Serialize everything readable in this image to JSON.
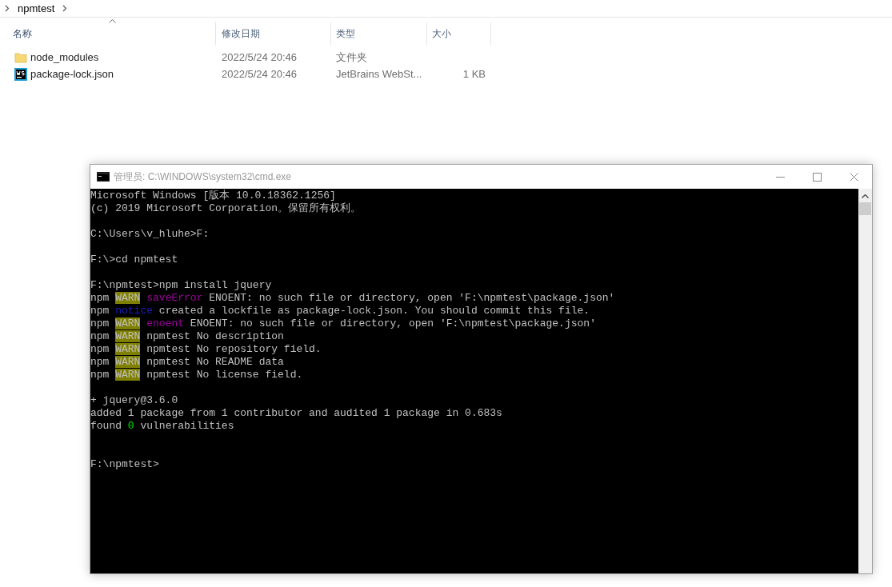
{
  "explorer": {
    "breadcrumb": [
      "npmtest"
    ],
    "columns": [
      {
        "label": "名称",
        "sorted": true
      },
      {
        "label": "修改日期",
        "sorted": false
      },
      {
        "label": "类型",
        "sorted": false
      },
      {
        "label": "大小",
        "sorted": false
      }
    ],
    "rows": [
      {
        "kind": "folder",
        "name": "node_modules",
        "date": "2022/5/24 20:46",
        "type": "文件夹"
      },
      {
        "kind": "webstorm",
        "name": "package-lock.json",
        "date": "2022/5/24 20:46",
        "type": "JetBrains WebSt...",
        "size": "1 KB"
      }
    ]
  },
  "console": {
    "title": "管理员: C:\\WINDOWS\\system32\\cmd.exe",
    "lines": [
      {
        "kind": "text",
        "segments": [
          {
            "kind": "plain",
            "text": "Microsoft Windows [版本 10.0.18362.1256]"
          }
        ]
      },
      {
        "kind": "text",
        "segments": [
          {
            "kind": "plain",
            "text": "(c) 2019 Microsoft Corporation。保留所有权利。"
          }
        ]
      },
      {
        "kind": "blank"
      },
      {
        "kind": "text",
        "segments": [
          {
            "kind": "plain",
            "text": "C:\\Users\\v_hluhe>F:"
          }
        ]
      },
      {
        "kind": "blank"
      },
      {
        "kind": "text",
        "segments": [
          {
            "kind": "plain",
            "text": "F:\\>cd npmtest"
          }
        ]
      },
      {
        "kind": "blank"
      },
      {
        "kind": "text",
        "segments": [
          {
            "kind": "plain",
            "text": "F:\\npmtest>npm install jquery"
          }
        ]
      },
      {
        "kind": "text",
        "segments": [
          {
            "kind": "plain",
            "text": "npm "
          },
          {
            "kind": "warn",
            "text": "WARN"
          },
          {
            "kind": "magenta",
            "text": " saveError"
          },
          {
            "kind": "plain",
            "text": " ENOENT: no such file or directory, open 'F:\\npmtest\\package.json'"
          }
        ]
      },
      {
        "kind": "text",
        "segments": [
          {
            "kind": "plain",
            "text": "npm "
          },
          {
            "kind": "notice",
            "text": "notice"
          },
          {
            "kind": "plain",
            "text": " created a lockfile as package-lock.json. You should commit this file."
          }
        ]
      },
      {
        "kind": "text",
        "segments": [
          {
            "kind": "plain",
            "text": "npm "
          },
          {
            "kind": "warn",
            "text": "WARN"
          },
          {
            "kind": "magenta",
            "text": " enoent"
          },
          {
            "kind": "plain",
            "text": " ENOENT: no such file or directory, open 'F:\\npmtest\\package.json'"
          }
        ]
      },
      {
        "kind": "text",
        "segments": [
          {
            "kind": "plain",
            "text": "npm "
          },
          {
            "kind": "warn",
            "text": "WARN"
          },
          {
            "kind": "plain",
            "text": " npmtest No description"
          }
        ]
      },
      {
        "kind": "text",
        "segments": [
          {
            "kind": "plain",
            "text": "npm "
          },
          {
            "kind": "warn",
            "text": "WARN"
          },
          {
            "kind": "plain",
            "text": " npmtest No repository field."
          }
        ]
      },
      {
        "kind": "text",
        "segments": [
          {
            "kind": "plain",
            "text": "npm "
          },
          {
            "kind": "warn",
            "text": "WARN"
          },
          {
            "kind": "plain",
            "text": " npmtest No README data"
          }
        ]
      },
      {
        "kind": "text",
        "segments": [
          {
            "kind": "plain",
            "text": "npm "
          },
          {
            "kind": "warn",
            "text": "WARN"
          },
          {
            "kind": "plain",
            "text": " npmtest No license field."
          }
        ]
      },
      {
        "kind": "blank"
      },
      {
        "kind": "text",
        "segments": [
          {
            "kind": "plain",
            "text": "+ jquery@3.6.0"
          }
        ]
      },
      {
        "kind": "text",
        "segments": [
          {
            "kind": "plain",
            "text": "added 1 package from 1 contributor and audited 1 package in 0.683s"
          }
        ]
      },
      {
        "kind": "text",
        "segments": [
          {
            "kind": "plain",
            "text": "found "
          },
          {
            "kind": "green",
            "text": "0"
          },
          {
            "kind": "plain",
            "text": " vulnerabilities"
          }
        ]
      },
      {
        "kind": "blank"
      },
      {
        "kind": "blank"
      },
      {
        "kind": "text",
        "segments": [
          {
            "kind": "plain",
            "text": "F:\\npmtest>"
          }
        ]
      }
    ]
  }
}
